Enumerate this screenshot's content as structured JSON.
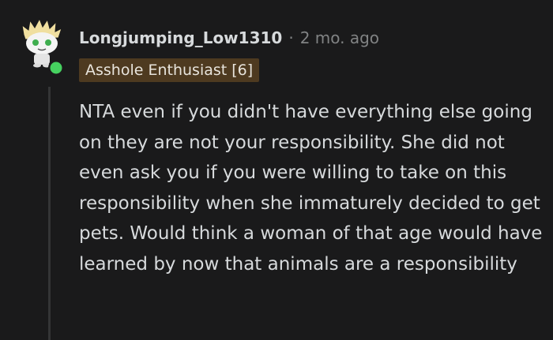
{
  "comment": {
    "author": "Longjumping_Low1310",
    "separator": "·",
    "timestamp": "2 mo. ago",
    "flair": "Asshole Enthusiast [6]",
    "body": "NTA even if you didn't have everything else going on they are not your responsibility. She did not even ask you if you were willing to take on this responsibility when she immaturely decided to get pets. Would think a woman of that age would have learned by now that animals are a responsibility",
    "avatar_icon": "snoo-avatar-icon",
    "online_status_icon": "online-dot-icon"
  },
  "colors": {
    "background": "#1a1a1b",
    "text": "#d7dadc",
    "meta": "#818384",
    "flair_bg": "#4e3a20",
    "online": "#46d160",
    "thread_line": "#343536"
  }
}
